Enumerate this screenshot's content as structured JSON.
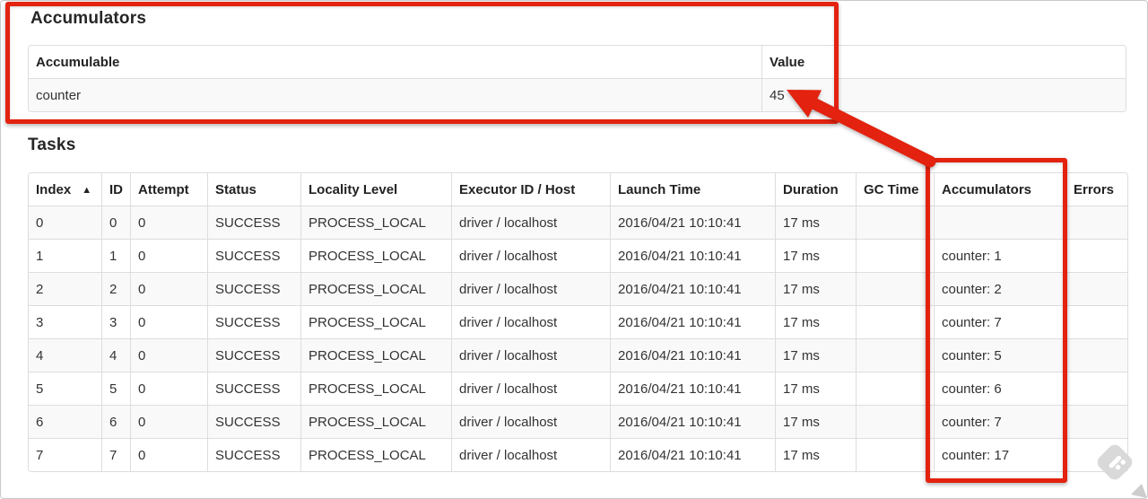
{
  "colors": {
    "annotation_red": "#e3220f",
    "row_stripe": "#f9f9f9",
    "table_border": "#dddddd",
    "text": "#333333"
  },
  "accumulators": {
    "title": "Accumulators",
    "headers": [
      "Accumulable",
      "Value"
    ],
    "rows": [
      [
        "counter",
        "45"
      ]
    ]
  },
  "tasks": {
    "title": "Tasks",
    "headers": [
      "Index",
      "ID",
      "Attempt",
      "Status",
      "Locality Level",
      "Executor ID / Host",
      "Launch Time",
      "Duration",
      "GC Time",
      "Accumulators",
      "Errors"
    ],
    "sort": {
      "column": "Index",
      "direction": "asc",
      "icon": "▲"
    },
    "rows": [
      [
        "0",
        "0",
        "0",
        "SUCCESS",
        "PROCESS_LOCAL",
        "driver / localhost",
        "2016/04/21 10:10:41",
        "17 ms",
        "",
        "",
        ""
      ],
      [
        "1",
        "1",
        "0",
        "SUCCESS",
        "PROCESS_LOCAL",
        "driver / localhost",
        "2016/04/21 10:10:41",
        "17 ms",
        "",
        "counter: 1",
        ""
      ],
      [
        "2",
        "2",
        "0",
        "SUCCESS",
        "PROCESS_LOCAL",
        "driver / localhost",
        "2016/04/21 10:10:41",
        "17 ms",
        "",
        "counter: 2",
        ""
      ],
      [
        "3",
        "3",
        "0",
        "SUCCESS",
        "PROCESS_LOCAL",
        "driver / localhost",
        "2016/04/21 10:10:41",
        "17 ms",
        "",
        "counter: 7",
        ""
      ],
      [
        "4",
        "4",
        "0",
        "SUCCESS",
        "PROCESS_LOCAL",
        "driver / localhost",
        "2016/04/21 10:10:41",
        "17 ms",
        "",
        "counter: 5",
        ""
      ],
      [
        "5",
        "5",
        "0",
        "SUCCESS",
        "PROCESS_LOCAL",
        "driver / localhost",
        "2016/04/21 10:10:41",
        "17 ms",
        "",
        "counter: 6",
        ""
      ],
      [
        "6",
        "6",
        "0",
        "SUCCESS",
        "PROCESS_LOCAL",
        "driver / localhost",
        "2016/04/21 10:10:41",
        "17 ms",
        "",
        "counter: 7",
        ""
      ],
      [
        "7",
        "7",
        "0",
        "SUCCESS",
        "PROCESS_LOCAL",
        "driver / localhost",
        "2016/04/21 10:10:41",
        "17 ms",
        "",
        "counter: 17",
        ""
      ]
    ]
  }
}
